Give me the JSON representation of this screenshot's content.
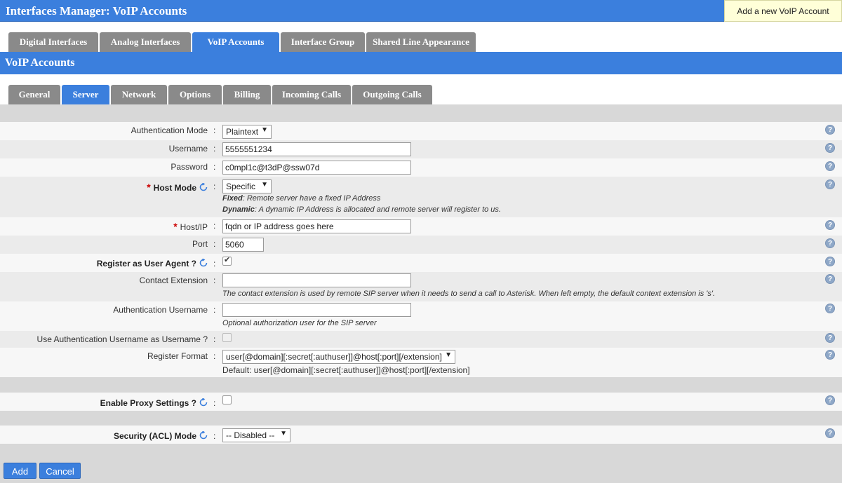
{
  "header": {
    "title": "Interfaces Manager:  VoIP Accounts",
    "add_button": "Add a new VoIP Account"
  },
  "main_tabs": [
    "Digital Interfaces",
    "Analog Interfaces",
    "VoIP Accounts",
    "Interface Group",
    "Shared Line Appearance"
  ],
  "main_tab_active": "VoIP Accounts",
  "section": {
    "title": "VoIP Accounts"
  },
  "sub_tabs": [
    "General",
    "Server",
    "Network",
    "Options",
    "Billing",
    "Incoming Calls",
    "Outgoing Calls"
  ],
  "sub_tab_active": "Server",
  "colon": ":",
  "help_glyph": "?",
  "form": {
    "auth_mode": {
      "label": "Authentication Mode",
      "value": "Plaintext"
    },
    "username": {
      "label": "Username",
      "value": "5555551234"
    },
    "password": {
      "label": "Password",
      "value": "c0mpl1c@t3dP@ssw07d"
    },
    "host_mode": {
      "label": "Host Mode",
      "value": "Specific",
      "fixed_term": "Fixed",
      "fixed_desc": ": Remote server have a fixed IP Address",
      "dynamic_term": "Dynamic",
      "dynamic_desc": ": A dynamic IP Address is allocated and remote server will register to us."
    },
    "host_ip": {
      "label": "Host/IP",
      "value": "fqdn or IP address goes here"
    },
    "port": {
      "label": "Port",
      "value": "5060"
    },
    "register_ua": {
      "label": "Register as User Agent ?",
      "checked": true
    },
    "contact_ext": {
      "label": "Contact Extension",
      "value": "",
      "hint": "The contact extension is used by remote SIP server when it needs to send a call to Asterisk. When left empty, the default context extension is 's'."
    },
    "auth_username": {
      "label": "Authentication Username",
      "value": "",
      "hint": "Optional authorization user for the SIP server"
    },
    "use_auth_as_user": {
      "label": "Use Authentication Username as Username ?",
      "checked": false
    },
    "register_format": {
      "label": "Register Format",
      "value": "user[@domain][:secret[:authuser]]@host[:port][/extension]",
      "default_text": "Default: user[@domain][:secret[:authuser]]@host[:port][/extension]"
    },
    "enable_proxy": {
      "label": "Enable Proxy Settings ?",
      "checked": false
    },
    "security_acl": {
      "label": "Security (ACL) Mode",
      "value": "-- Disabled --"
    }
  },
  "buttons": {
    "add": "Add",
    "cancel": "Cancel"
  },
  "colors": {
    "accent": "#3b7fdd",
    "tab_inactive": "#8a8a8a",
    "required": "#cc0000",
    "tooltip_bg": "#ffffd8"
  }
}
